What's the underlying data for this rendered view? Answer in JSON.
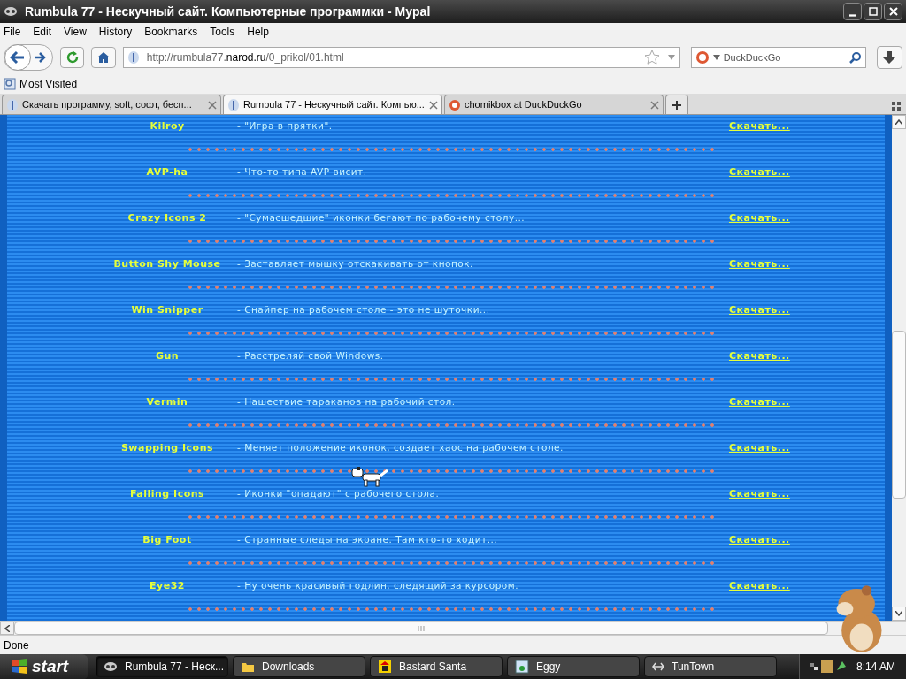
{
  "window": {
    "title": "Rumbula 77 - Нескучный сайт. Компьютерные программки - Mypal"
  },
  "menu": [
    "File",
    "Edit",
    "View",
    "History",
    "Bookmarks",
    "Tools",
    "Help"
  ],
  "address_bar": {
    "url_prefix": "http://rumbula77.",
    "url_domain": "narod.ru",
    "url_path": "/0_prikol/01.html"
  },
  "search": {
    "placeholder": "DuckDuckGo"
  },
  "bookmarks": [
    "Most Visited"
  ],
  "tabs": [
    {
      "label": "Скачать программу, soft, софт, бесп...",
      "selected": false,
      "kind": "site"
    },
    {
      "label": "Rumbula 77 - Нескучный сайт. Компью...",
      "selected": true,
      "kind": "site"
    },
    {
      "label": "chomikbox at DuckDuckGo",
      "selected": false,
      "kind": "duck"
    }
  ],
  "programs": [
    {
      "name": "Kilroy",
      "description": "- \"Игра в прятки\".",
      "link": "Скачать..."
    },
    {
      "name": "AVP-ha",
      "description": "- Что-то типа AVP висит.",
      "link": "Скачать..."
    },
    {
      "name": "Crazy Icons 2",
      "description": "- \"Сумасшедшие\" иконки бегают по рабочему столу...",
      "link": "Скачать..."
    },
    {
      "name": "Button Shy Mouse",
      "description": "- Заставляет мышку отскакивать от кнопок.",
      "link": "Скачать..."
    },
    {
      "name": "Win Snipper",
      "description": "- Снайпер на рабочем столе - это не шуточки...",
      "link": "Скачать..."
    },
    {
      "name": "Gun",
      "description": "- Расстреляй свой Windows.",
      "link": "Скачать..."
    },
    {
      "name": "Vermin",
      "description": "- Нашествие тараканов на рабочий стол.",
      "link": "Скачать..."
    },
    {
      "name": "Swapping Icons",
      "description": "- Меняет положение иконок, создает хаос на рабочем столе.",
      "link": "Скачать..."
    },
    {
      "name": "Falling Icons",
      "description": "- Иконки \"опадают\" с рабочего стола.",
      "link": "Скачать..."
    },
    {
      "name": "Big Foot",
      "description": "- Странные следы на экране. Там кто-то ходит...",
      "link": "Скачать..."
    },
    {
      "name": "Eye32",
      "description": "- Ну очень красивый годлин, следящий за курсором.",
      "link": "Скачать..."
    }
  ],
  "status_bar": {
    "text": "Done"
  },
  "taskbar": {
    "start": "start",
    "items": [
      {
        "label": "Rumbula 77 - Неск...",
        "selected": true,
        "kind": "browser"
      },
      {
        "label": "Downloads",
        "selected": false,
        "kind": "folder"
      },
      {
        "label": "Bastard Santa",
        "selected": false,
        "kind": "santa"
      },
      {
        "label": "Eggy",
        "selected": false,
        "kind": "app"
      },
      {
        "label": "TunTown",
        "selected": false,
        "kind": "tool"
      }
    ],
    "clock": "8:14 AM"
  }
}
